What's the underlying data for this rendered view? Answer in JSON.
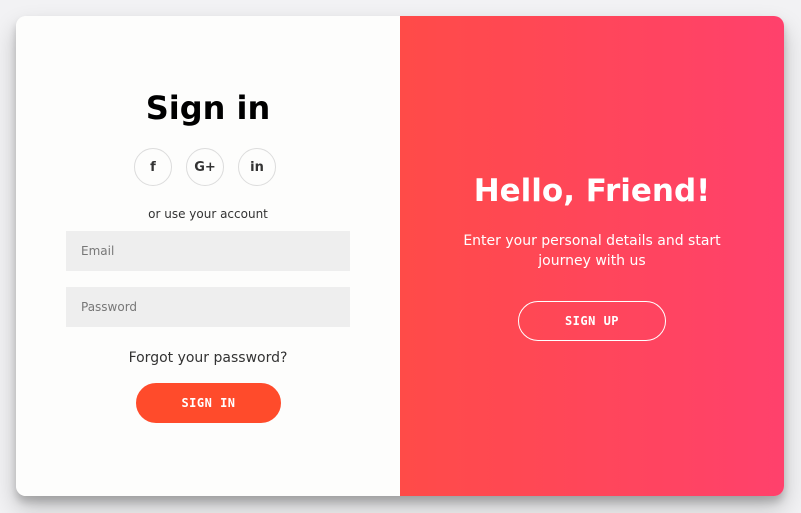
{
  "signin": {
    "title": "Sign in",
    "social": {
      "facebook": "f",
      "google": "G+",
      "linkedin": "in"
    },
    "alt_text": "or use your account",
    "email_placeholder": "Email",
    "password_placeholder": "Password",
    "forgot_label": "Forgot your password?",
    "button_label": "SIGN IN"
  },
  "overlay": {
    "title": "Hello, Friend!",
    "text": "Enter your personal details and start journey with us",
    "button_label": "SIGN UP"
  },
  "colors": {
    "accent": "#ff4b2b",
    "gradient_start": "#ff4b48",
    "gradient_end": "#ff416c"
  }
}
